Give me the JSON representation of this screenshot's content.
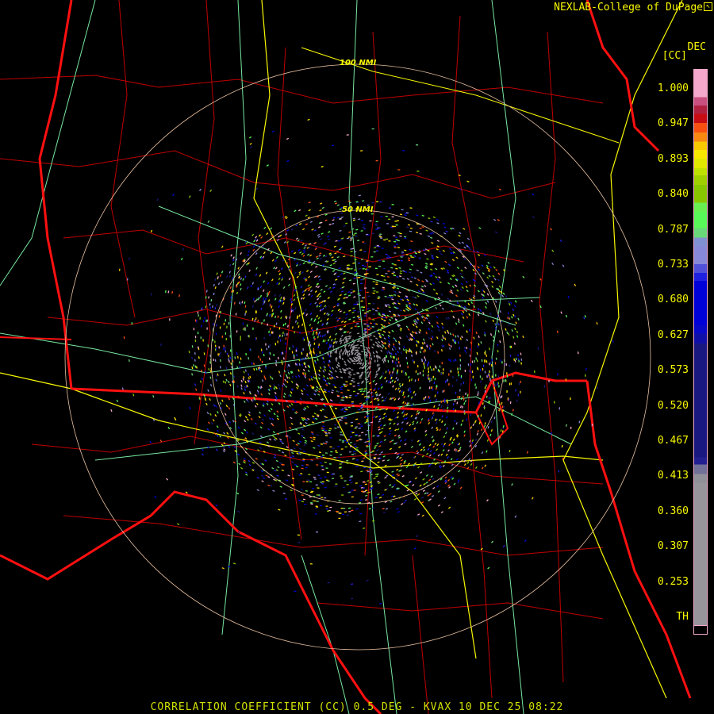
{
  "header": {
    "credit": "NEXLAB-College of DuPage",
    "credit_icon": "cursor-arrow-icon"
  },
  "legend": {
    "units": "DEC",
    "product": "[CC]",
    "ticks": [
      "1.000",
      "0.947",
      "0.893",
      "0.840",
      "0.787",
      "0.733",
      "0.680",
      "0.627",
      "0.573",
      "0.520",
      "0.467",
      "0.413",
      "0.360",
      "0.307",
      "0.253",
      "TH"
    ]
  },
  "map": {
    "ring_outer_label": "100 NMI",
    "ring_inner_label": "50 NMI",
    "colors": {
      "state_border": "#ff1010",
      "county_border": "#c00000",
      "highway_major": "#f8f800",
      "highway": "#78e8a0",
      "range_ring": "#e8c0a0"
    }
  },
  "footer": {
    "caption": "CORRELATION COEFFICIENT (CC) 0.5 DEG - KVAX 10 DEC 25 08:22"
  }
}
